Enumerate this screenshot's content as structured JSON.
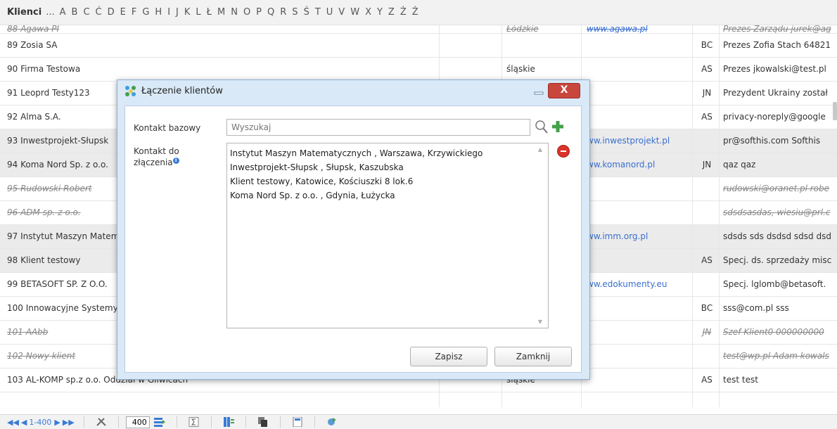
{
  "alphabet": {
    "title": "Klienci",
    "ellipsis": "...",
    "letters": [
      "A",
      "B",
      "C",
      "Ć",
      "D",
      "E",
      "F",
      "G",
      "H",
      "I",
      "J",
      "K",
      "L",
      "Ł",
      "M",
      "N",
      "O",
      "P",
      "Q",
      "R",
      "S",
      "Ś",
      "T",
      "U",
      "V",
      "W",
      "X",
      "Y",
      "Z",
      "Ż",
      "Ź"
    ]
  },
  "rows": [
    {
      "name": "88 Agawa PI",
      "region": "Łódzkie",
      "www": "www.agawa.pl",
      "code": "",
      "desc": "Prezes Zarządu jurek@ag",
      "deleted": true
    },
    {
      "name": "89 Zosia SA",
      "region": "",
      "www": "",
      "code": "BC",
      "desc": "Prezes Zofia Stach 64821",
      "deleted": false
    },
    {
      "name": "90 Firma Testowa",
      "region": "śląskie",
      "www": "",
      "code": "AS",
      "desc": "Prezes jkowalski@test.pl",
      "deleted": false
    },
    {
      "name": "91 Leoprd Testy123",
      "region": "",
      "www": "",
      "code": "JN",
      "desc": "Prezydent Ukrainy został",
      "deleted": false
    },
    {
      "name": "92 Alma S.A.",
      "region": "",
      "www": "",
      "code": "AS",
      "desc": "privacy-noreply@google",
      "deleted": false
    },
    {
      "name": "93 Inwestprojekt-Słupsk",
      "region": "",
      "www": "ww.inwestprojekt.pl",
      "code": "",
      "desc": "pr@softhis.com Softhis",
      "deleted": false,
      "shaded": true
    },
    {
      "name": "94 Koma Nord Sp. z o.o.",
      "region": "",
      "www": "ww.komanord.pl",
      "code": "JN",
      "desc": "qaz qaz",
      "deleted": false,
      "shaded": true
    },
    {
      "name": "95 Rudowski Robert",
      "region": "",
      "www": "",
      "code": "",
      "desc": "rudowski@oranet.pl robe",
      "deleted": true
    },
    {
      "name": "96 ADM sp. z o.o.",
      "region": "",
      "www": "",
      "code": "",
      "desc": "sdsdsasdas, wiesiu@prl.c",
      "deleted": true
    },
    {
      "name": "97 Instytut Maszyn Matematycznych",
      "region": "",
      "www": "ww.imm.org.pl",
      "code": "",
      "desc": "sdsds sds dsdsd sdsd dsd",
      "deleted": false,
      "shaded": true
    },
    {
      "name": "98 Klient testowy",
      "region": "",
      "www": "",
      "code": "AS",
      "desc": "Specj. ds. sprzedaży misc",
      "deleted": false,
      "shaded": true
    },
    {
      "name": "99 BETASOFT SP. Z O.O.",
      "region": "",
      "www": "ww.edokumenty.eu",
      "code": "",
      "desc": "Specj. lglomb@betasoft.",
      "deleted": false
    },
    {
      "name": "100 Innowacyjne Systemy",
      "region": "",
      "www": "",
      "code": "BC",
      "desc": "sss@com.pl sss",
      "deleted": false
    },
    {
      "name": "101 AAbb",
      "region": "",
      "www": "",
      "code": "JN",
      "desc": "Szef Klient0 000000000",
      "deleted": true
    },
    {
      "name": "102 Nowy klient",
      "region": "",
      "www": "",
      "code": "",
      "desc": "test@wp.pl Adam kowals",
      "deleted": true
    },
    {
      "name": "103 AL-KOMP sp.z o.o. Oddział w Gliwicach",
      "region": "śląskie",
      "www": "",
      "code": "AS",
      "desc": "test test",
      "deleted": false
    }
  ],
  "toolbar": {
    "range": "1-400",
    "page_size": "400"
  },
  "dialog": {
    "title": "Łączenie klientów",
    "base_label": "Kontakt bazowy",
    "join_label_line1": "Kontakt do",
    "join_label_line2": "złączenia",
    "search_placeholder": "Wyszukaj",
    "items": [
      "Instytut Maszyn Matematycznych , Warszawa, Krzywickiego",
      "Inwestprojekt-Słupsk , Słupsk, Kaszubska",
      "Klient testowy, Katowice, Kościuszki 8 lok.6",
      "Koma Nord Sp. z o.o. , Gdynia, Łużycka"
    ],
    "save_label": "Zapisz",
    "close_label": "Zamknij",
    "close_x": "X"
  },
  "colors": {
    "link": "#3a6fcf",
    "dialog_bg": "#d9e9f7",
    "close_red": "#c9463d"
  }
}
